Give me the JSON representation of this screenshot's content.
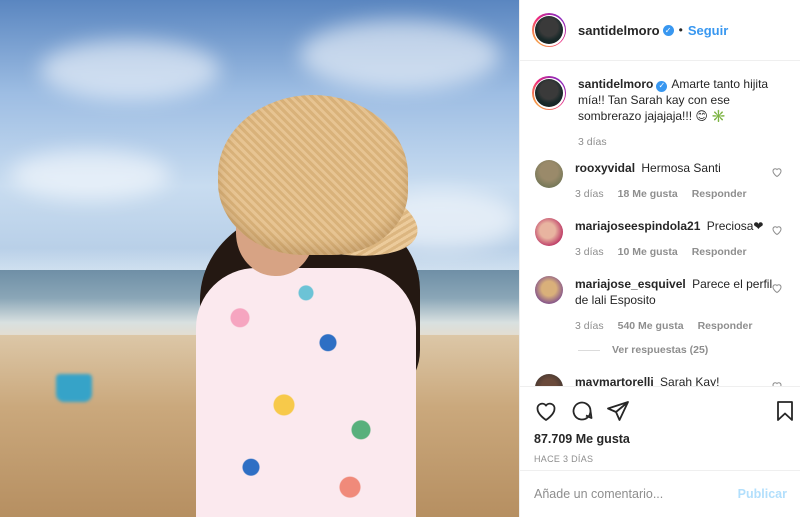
{
  "header": {
    "username": "santidelmoro",
    "separator": "•",
    "follow_label": "Seguir"
  },
  "caption": {
    "username": "santidelmoro",
    "text": "Amarte tanto hijita mía!! Tan Sarah kay con ese sombrerazo jajajaja!!! 😊 ✳️",
    "time": "3 días"
  },
  "comments": [
    {
      "username": "rooxyvidal",
      "text": "Hermosa Santi",
      "time": "3 días",
      "likes": "18 Me gusta",
      "reply": "Responder"
    },
    {
      "username": "mariajoseespindola21",
      "text": "Preciosa❤",
      "time": "3 días",
      "likes": "10 Me gusta",
      "reply": "Responder"
    },
    {
      "username": "mariajose_esquivel",
      "text": "Parece el perfil de lali Esposito",
      "time": "3 días",
      "likes": "540 Me gusta",
      "reply": "Responder",
      "view_replies": "Ver respuestas (25)"
    },
    {
      "username": "maymartorelli",
      "text": "Sarah Kay!"
    }
  ],
  "post": {
    "likes": "87.709 Me gusta",
    "date": "HACE 3 DÍAS"
  },
  "add_comment": {
    "placeholder": "Añade un comentario...",
    "publish_label": "Publicar"
  },
  "icons": {
    "verified": "verified-badge-icon",
    "like": "heart-icon",
    "comment": "comment-bubble-icon",
    "share": "paper-plane-icon",
    "save": "bookmark-icon"
  },
  "colors": {
    "link": "#3897f0",
    "publish_disabled": "#b2dffc",
    "muted": "#8e8e8e",
    "text": "#262626"
  }
}
